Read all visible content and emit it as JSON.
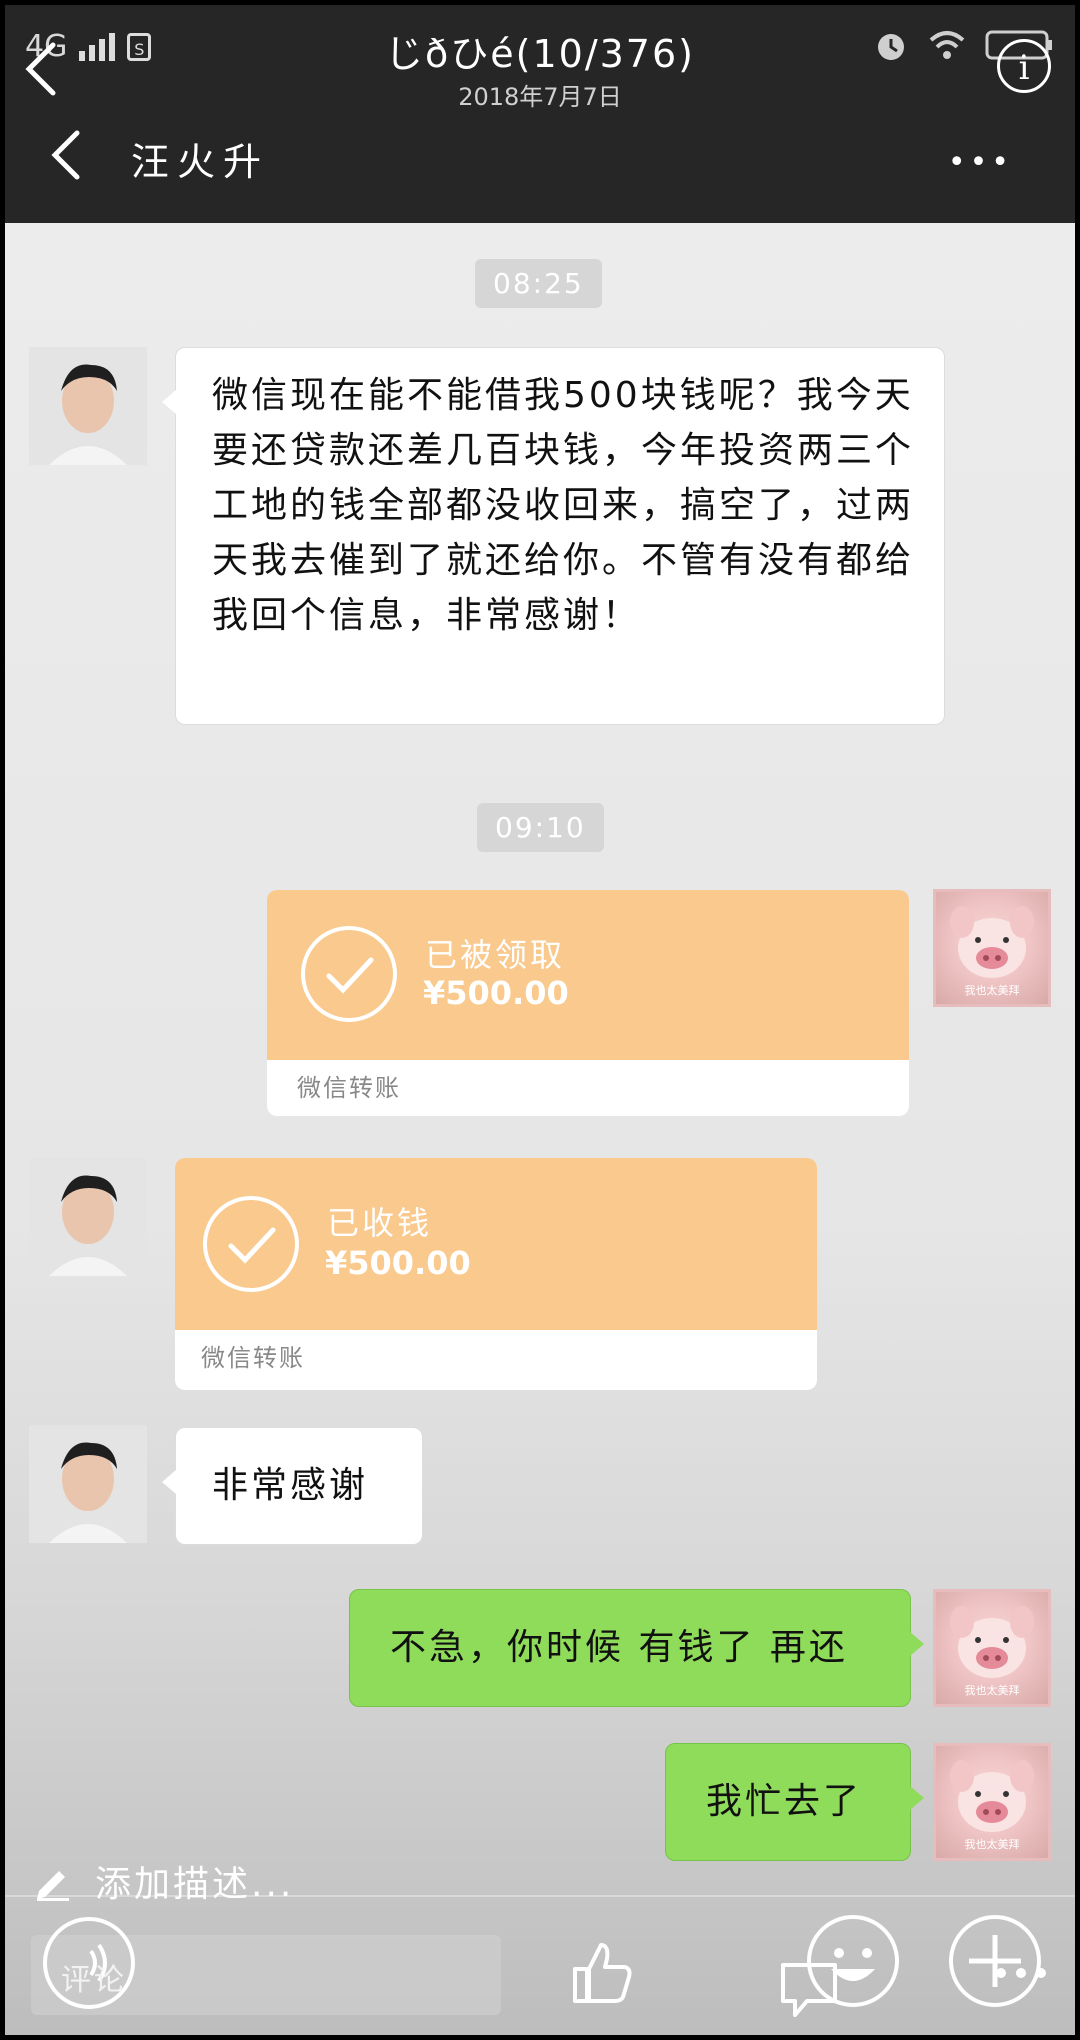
{
  "viewer": {
    "title": "じðひé(10/376)",
    "date": "2018年7月7日",
    "network": "4G",
    "sim_label": "S"
  },
  "chat_header": {
    "contact_name": "汪火升",
    "more_label": "•••"
  },
  "messages": [
    {
      "type": "time",
      "text": "08:25"
    },
    {
      "type": "text",
      "side": "left",
      "text": "微信现在能不能借我500块钱呢？我今天要还贷款还差几百块钱，今年投资两三个工地的钱全部都没收回来，搞空了，过两天我去催到了就还给你。不管有没有都给我回个信息，非常感谢！"
    },
    {
      "type": "time",
      "text": "09:10"
    },
    {
      "type": "transfer",
      "side": "right",
      "status": "已被领取",
      "amount": "¥500.00",
      "label": "微信转账"
    },
    {
      "type": "transfer",
      "side": "left",
      "status": "已收钱",
      "amount": "¥500.00",
      "label": "微信转账"
    },
    {
      "type": "text",
      "side": "left",
      "text": "非常感谢"
    },
    {
      "type": "text",
      "side": "right",
      "text": "不急，你时候 有钱了 再还"
    },
    {
      "type": "text",
      "side": "right",
      "text": "我忙去了"
    }
  ],
  "avatar_pig_caption": "我也太美拜",
  "bottom": {
    "add_description": "添加描述...",
    "comment_placeholder": "评论"
  },
  "colors": {
    "header_bg": "#262626",
    "chat_bg": "#ececec",
    "transfer_orange": "#f9c98e",
    "bubble_green": "#8fdc5a"
  },
  "icons": [
    "back-arrow-icon",
    "signal-icon",
    "sim-icon",
    "alarm-icon",
    "wifi-icon",
    "battery-icon",
    "info-icon",
    "more-icon",
    "check-circle-icon",
    "pencil-icon",
    "voice-icon",
    "thumbs-up-icon",
    "chat-icon",
    "emoji-icon",
    "plus-icon"
  ]
}
